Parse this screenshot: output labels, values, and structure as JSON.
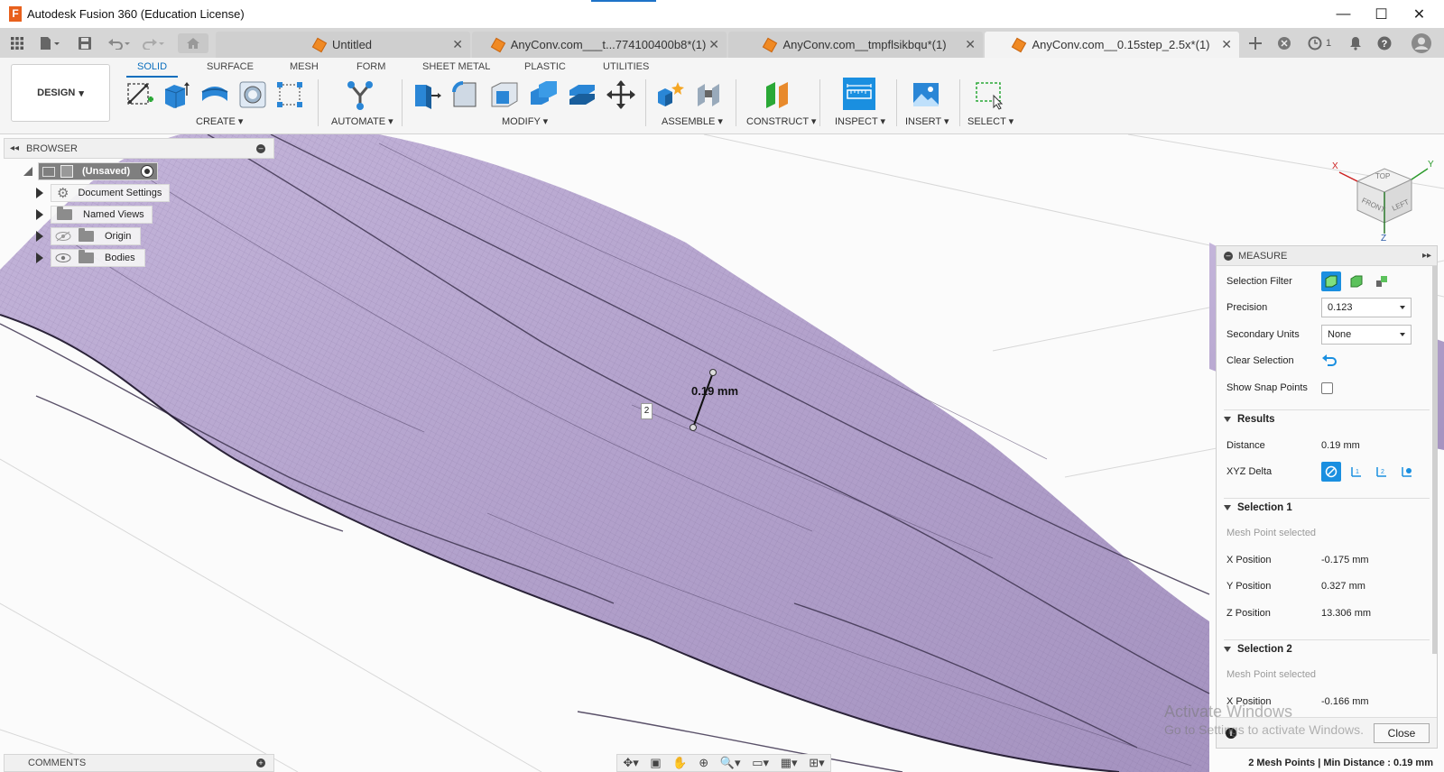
{
  "window": {
    "title": "Autodesk Fusion 360 (Education License)",
    "minimize": "—",
    "maximize": "☐",
    "close": "✕"
  },
  "tabs": [
    {
      "label": "Untitled"
    },
    {
      "label": "AnyConv.com___t...774100400b8*(1)"
    },
    {
      "label": "AnyConv.com__tmpflsikbqu*(1)"
    },
    {
      "label": "AnyConv.com__0.15step_2.5x*(1)"
    }
  ],
  "topbar": {
    "jobs_count": "1"
  },
  "toolbar": {
    "design_label": "DESIGN",
    "workspaces": [
      "SOLID",
      "SURFACE",
      "MESH",
      "FORM",
      "SHEET METAL",
      "PLASTIC",
      "UTILITIES"
    ],
    "groups": {
      "create": "CREATE",
      "automate": "AUTOMATE",
      "modify": "MODIFY",
      "assemble": "ASSEMBLE",
      "construct": "CONSTRUCT",
      "inspect": "INSPECT",
      "insert": "INSERT",
      "select": "SELECT"
    }
  },
  "browser": {
    "title": "BROWSER",
    "root": "(Unsaved)",
    "items": [
      {
        "label": "Document Settings"
      },
      {
        "label": "Named Views"
      },
      {
        "label": "Origin"
      },
      {
        "label": "Bodies"
      }
    ]
  },
  "viewcube": {
    "top": "TOP",
    "front": "FRONT",
    "left": "LEFT",
    "axis_x": "X",
    "axis_y": "Y",
    "axis_z": "Z"
  },
  "annotation": {
    "distance_label": "0.19 mm",
    "point_marker": "2"
  },
  "measure": {
    "title": "MEASURE",
    "selection_filter_label": "Selection Filter",
    "precision_label": "Precision",
    "precision_value": "0.123",
    "secondary_units_label": "Secondary Units",
    "secondary_units_value": "None",
    "clear_selection_label": "Clear Selection",
    "show_snap_points_label": "Show Snap Points",
    "results_title": "Results",
    "distance_label": "Distance",
    "distance_value": "0.19 mm",
    "xyz_delta_label": "XYZ Delta",
    "selection1_title": "Selection 1",
    "selection1_status": "Mesh Point selected",
    "x_label": "X Position",
    "x_value": "-0.175 mm",
    "y_label": "Y Position",
    "y_value": "0.327 mm",
    "z_label": "Z Position",
    "z_value": "13.306 mm",
    "selection2_title": "Selection 2",
    "selection2_status": "Mesh Point selected",
    "x2_label": "X Position",
    "x2_value": "-0.166 mm",
    "close_label": "Close"
  },
  "watermark": {
    "line1": "Activate Windows",
    "line2": "Go to Settings to activate Windows."
  },
  "comments": {
    "title": "COMMENTS"
  },
  "status": {
    "text": "2 Mesh Points | Min Distance : 0.19 mm"
  },
  "colors": {
    "mesh": "#b5a3cf",
    "mesh_dark": "#8f7cad",
    "accent": "#0a6ebd",
    "selected_icon": "#1a8fe0"
  }
}
